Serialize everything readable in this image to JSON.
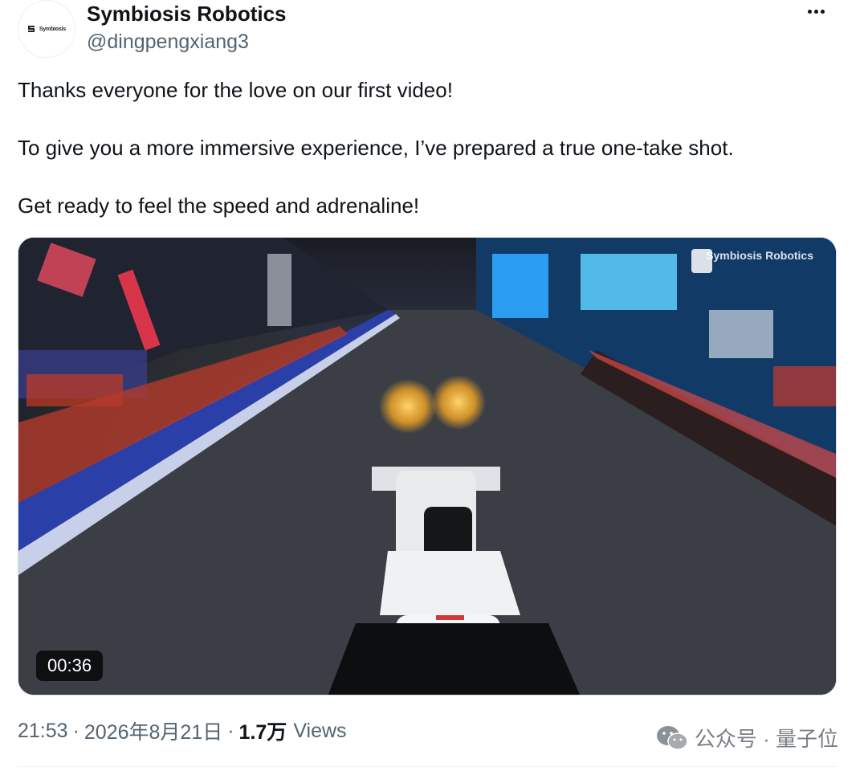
{
  "author": {
    "display_name": "Symbiosis Robotics",
    "handle": "@dingpengxiang3",
    "avatar_text": "Symbiosis"
  },
  "more_icon": "more-horizontal-icon",
  "tweet": {
    "paragraphs": [
      "Thanks everyone for the love on our first video!",
      "To give you a more immersive experience, I’ve prepared a true one-take shot.",
      "Get ready to feel the speed and adrenaline!"
    ]
  },
  "media": {
    "watermark": "Symbiosis Robotics",
    "duration": "00:36"
  },
  "meta": {
    "time": "21:53",
    "date": "2026年8月21日",
    "views_count": "1.7万",
    "views_label": "Views"
  },
  "watermark_footer": {
    "text": "公众号 · 量子位",
    "icon": "wechat-icon"
  }
}
